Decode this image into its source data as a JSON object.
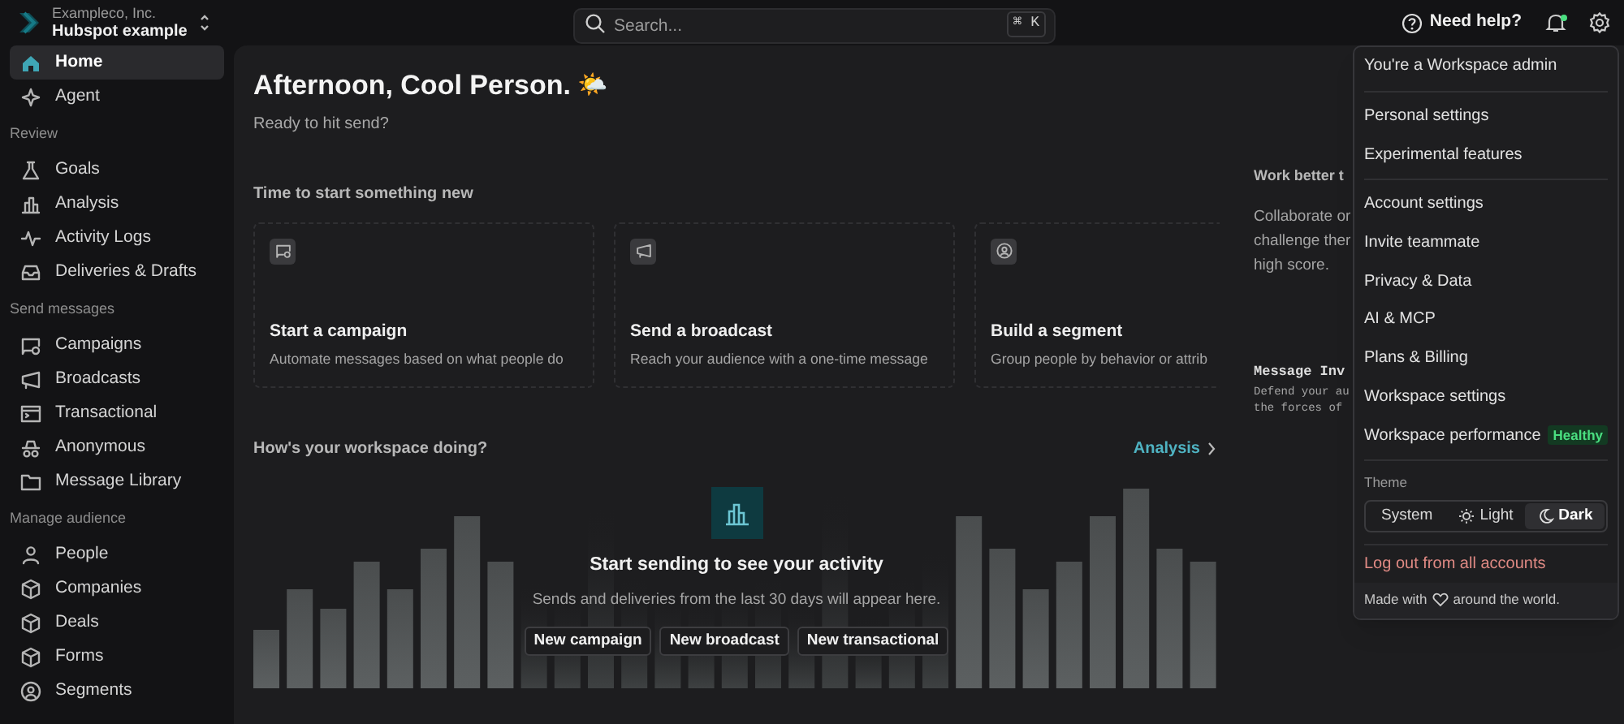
{
  "workspace": {
    "company": "Exampleco, Inc.",
    "name": "Hubspot example"
  },
  "sidebar": {
    "top_items": [
      {
        "label": "Home",
        "selected": true
      },
      {
        "label": "Agent",
        "selected": false
      }
    ],
    "sections": [
      {
        "title": "Review",
        "items": [
          {
            "label": "Goals",
            "selected": false
          },
          {
            "label": "Analysis",
            "selected": false
          },
          {
            "label": "Activity Logs",
            "selected": false
          },
          {
            "label": "Deliveries & Drafts",
            "selected": false
          }
        ]
      },
      {
        "title": "Send messages",
        "items": [
          {
            "label": "Campaigns",
            "selected": false
          },
          {
            "label": "Broadcasts",
            "selected": false
          },
          {
            "label": "Transactional",
            "selected": false
          },
          {
            "label": "Anonymous",
            "selected": false
          },
          {
            "label": "Message Library",
            "selected": false
          }
        ]
      },
      {
        "title": "Manage audience",
        "items": [
          {
            "label": "People",
            "selected": false
          },
          {
            "label": "Companies",
            "selected": false
          },
          {
            "label": "Deals",
            "selected": false
          },
          {
            "label": "Forms",
            "selected": false
          },
          {
            "label": "Segments",
            "selected": false
          }
        ]
      }
    ]
  },
  "search": {
    "placeholder": "Search...",
    "shortcut": "⌘ K"
  },
  "help": "Need help?",
  "notifications": {
    "unread": true
  },
  "greeting": {
    "title": "Afternoon, Cool Person.",
    "emoji": "🌤️",
    "subtitle": "Ready to hit send?"
  },
  "start_section": {
    "title": "Time to start something new",
    "cards": [
      {
        "title": "Start a campaign",
        "description": "Automate messages based on what people do"
      },
      {
        "title": "Send a broadcast",
        "description": "Reach your audience with a one-time message"
      },
      {
        "title": "Build a segment",
        "description": "Group people by behavior or attrib"
      }
    ]
  },
  "side_panel": {
    "title": "Work better t",
    "lines": [
      "Collaborate or",
      "challenge ther",
      "high score."
    ],
    "game_title": "Message Inv",
    "game_lines": [
      "Defend your au",
      "the forces of"
    ]
  },
  "workspace_section": {
    "title": "How's your workspace doing?",
    "link": "Analysis",
    "empty_title": "Start sending to see your activity",
    "empty_text": "Sends and deliveries from the last 30 days will appear here.",
    "buttons": [
      "New campaign",
      "New broadcast",
      "New transactional"
    ]
  },
  "menu": {
    "groups": [
      [
        {
          "label": "You're a Workspace admin"
        }
      ],
      [
        {
          "label": "Personal settings"
        },
        {
          "label": "Experimental features"
        }
      ],
      [
        {
          "label": "Account settings"
        },
        {
          "label": "Invite teammate"
        },
        {
          "label": "Privacy & Data"
        },
        {
          "label": "AI & MCP"
        },
        {
          "label": "Plans & Billing"
        },
        {
          "label": "Workspace settings"
        },
        {
          "label": "Workspace performance",
          "badge": "Healthy"
        }
      ]
    ],
    "theme_label": "Theme",
    "theme_options": [
      {
        "label": "System",
        "selected": false
      },
      {
        "label": "Light",
        "selected": false
      },
      {
        "label": "Dark",
        "selected": true
      }
    ],
    "logout": "Log out from all accounts",
    "footer": {
      "before": "Made with",
      "after": "around the world."
    }
  }
}
